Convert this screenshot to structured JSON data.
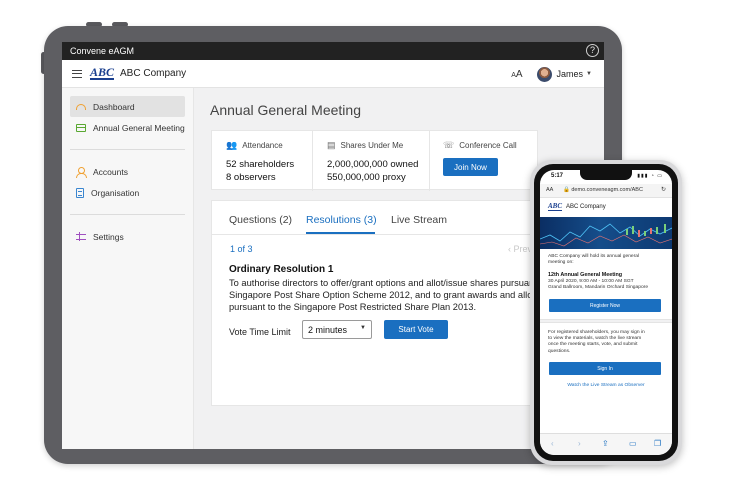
{
  "window": {
    "title": "Convene eAGM",
    "help_glyph": "?"
  },
  "appbar": {
    "logo_text": "ABC",
    "company": "ABC Company",
    "font_size_glyph": "A",
    "user_name": "James"
  },
  "sidebar": {
    "items": [
      {
        "label": "Dashboard",
        "icon": "dashboard-icon",
        "active": true
      },
      {
        "label": "Annual General Meeting",
        "icon": "calendar-icon"
      },
      {
        "label": "Accounts",
        "icon": "user-icon"
      },
      {
        "label": "Organisation",
        "icon": "building-icon"
      },
      {
        "label": "Settings",
        "icon": "sliders-icon"
      }
    ]
  },
  "main": {
    "page_title": "Annual General Meeting",
    "attendance": {
      "heading": "Attendance",
      "line1": "52 shareholders",
      "line2": "8 observers"
    },
    "shares": {
      "heading": "Shares Under Me",
      "line1": "2,000,000,000 owned",
      "line2": "550,000,000 proxy"
    },
    "conference": {
      "heading": "Conference Call",
      "button": "Join Now"
    },
    "tabs": [
      {
        "label": "Questions (2)"
      },
      {
        "label": "Resolutions (3)",
        "active": true
      },
      {
        "label": "Live Stream"
      }
    ],
    "pager": "1 of 3",
    "prev": "‹ Prev",
    "resolution": {
      "title": "Ordinary Resolution 1",
      "line1": "To authorise directors to offer/grant options and allot/issue shares pursuant",
      "line2": "Singapore Post Share Option Scheme 2012, and to grant awards and allot/issu",
      "line3": "pursuant to the Singapore Post Restricted Share Plan 2013."
    },
    "vote_label": "Vote Time Limit",
    "vote_value": "2 minutes",
    "start_button": "Start Vote"
  },
  "phone": {
    "time": "5:17",
    "status": "▮▮▮ ◔ ▭",
    "aa": "AA",
    "url": "🔒 demo.conveneagm.com/ABC",
    "reload": "↻",
    "logo_text": "ABC",
    "company": "ABC Company",
    "intro1": "ABC Company will hold its annual general",
    "intro2": "meeting on:",
    "meeting_title": "12th Annual General Meeting",
    "meeting_time": "30 April 2020, 9:00 AM - 10:00 AM SGT",
    "meeting_venue": "Grand Ballroom, Mandarin Orchard Singapore",
    "register_button": "Register Now",
    "info1": "For registered shareholders, you may sign in",
    "info2": "to view the materials, watch the live stream",
    "info3": "once the meeting starts, vote, and submit",
    "info4": "questions.",
    "signin_button": "Sign In",
    "observer_link": "Watch the Live Stream as Observer"
  },
  "colors": {
    "accent": "#1a6fc0",
    "brand": "#1a3f8f",
    "device": "#5e5e62"
  }
}
